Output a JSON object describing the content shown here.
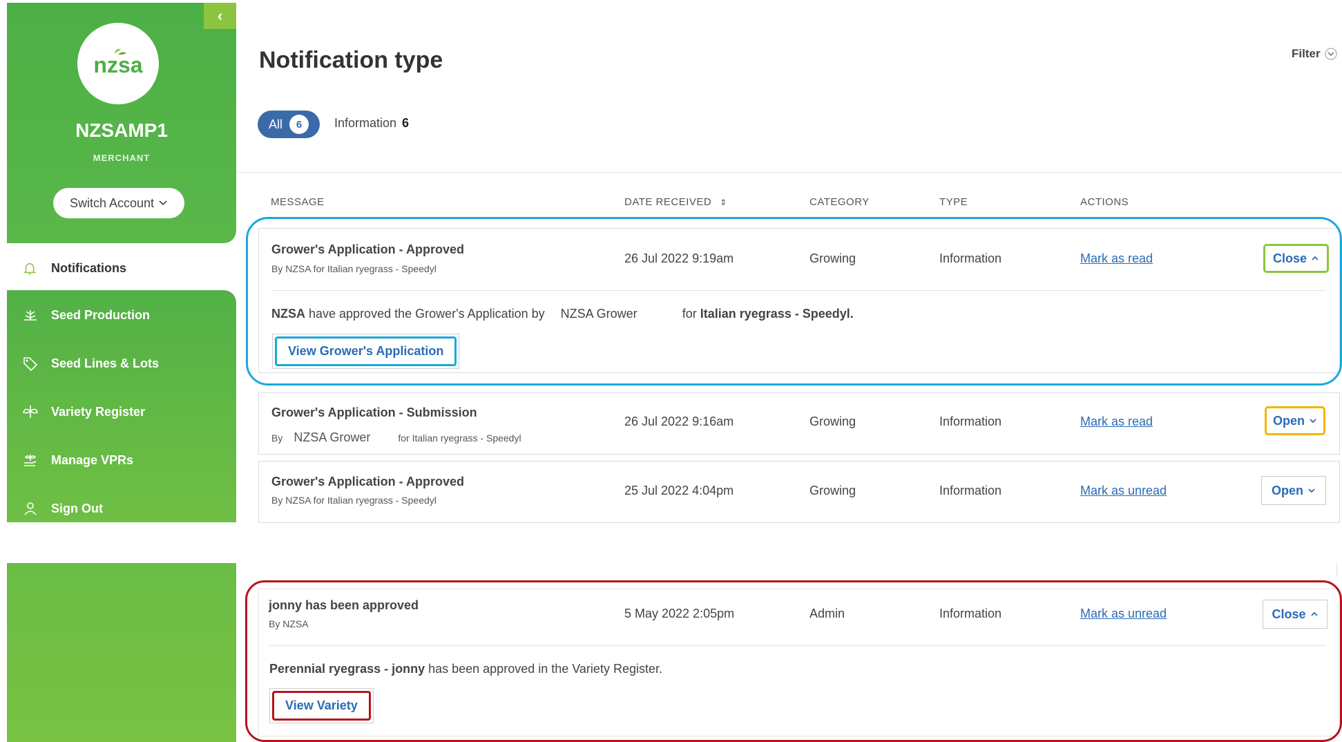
{
  "sidebar": {
    "logo_text": "nzsa",
    "account_name": "NZSAMP1",
    "account_role": "MERCHANT",
    "switch_label": "Switch Account",
    "items": [
      {
        "label": "Notifications"
      },
      {
        "label": "Seed Production"
      },
      {
        "label": "Seed Lines & Lots"
      },
      {
        "label": "Variety Register"
      },
      {
        "label": "Manage VPRs"
      },
      {
        "label": "Sign Out"
      }
    ]
  },
  "header": {
    "title": "Notification type",
    "filter_label": "Filter",
    "tabs": {
      "all_label": "All",
      "all_count": "6",
      "info_label": "Information",
      "info_count": "6"
    }
  },
  "table": {
    "columns": [
      "MESSAGE",
      "DATE RECEIVED",
      "CATEGORY",
      "TYPE",
      "ACTIONS"
    ],
    "rows": [
      {
        "title": "Grower's Application - Approved",
        "sub": "By NZSA for Italian ryegrass - Speedyl",
        "date": "26 Jul 2022 9:19am",
        "category": "Growing",
        "type": "Information",
        "mark": "Mark as read",
        "action": "Close",
        "detail_a": "NZSA",
        "detail_b": " have approved the Grower's Application by ",
        "detail_c": "NZSA Grower",
        "detail_d": " for ",
        "detail_e": "Italian ryegrass - Speedyl.",
        "detail_button": "View Grower's Application"
      },
      {
        "title": "Grower's Application - Submission",
        "sub_a": "By",
        "sub_b": "NZSA Grower",
        "sub_c": "for Italian ryegrass - Speedyl",
        "date": "26 Jul 2022 9:16am",
        "category": "Growing",
        "type": "Information",
        "mark": "Mark as read",
        "action": "Open"
      },
      {
        "title": "Grower's Application - Approved",
        "sub": "By NZSA for Italian ryegrass - Speedyl",
        "date": "25 Jul 2022 4:04pm",
        "category": "Growing",
        "type": "Information",
        "mark": "Mark as unread",
        "action": "Open"
      },
      {
        "title": "jonny has been approved",
        "sub": "By NZSA",
        "date": "5 May 2022 2:05pm",
        "category": "Admin",
        "type": "Information",
        "mark": "Mark as unread",
        "action": "Close",
        "detail_a": "Perennial ryegrass - jonny",
        "detail_b": " has been approved in the Variety Register.",
        "detail_button": "View Variety"
      }
    ]
  },
  "colors": {
    "brand_green": "#4caf45",
    "primary_blue": "#3b6aa8",
    "link_blue": "#2a6bb7",
    "highlight_blue": "#1aa8df",
    "highlight_green": "#8bc53f",
    "highlight_yellow": "#f5b400",
    "highlight_red": "#b7121c"
  }
}
